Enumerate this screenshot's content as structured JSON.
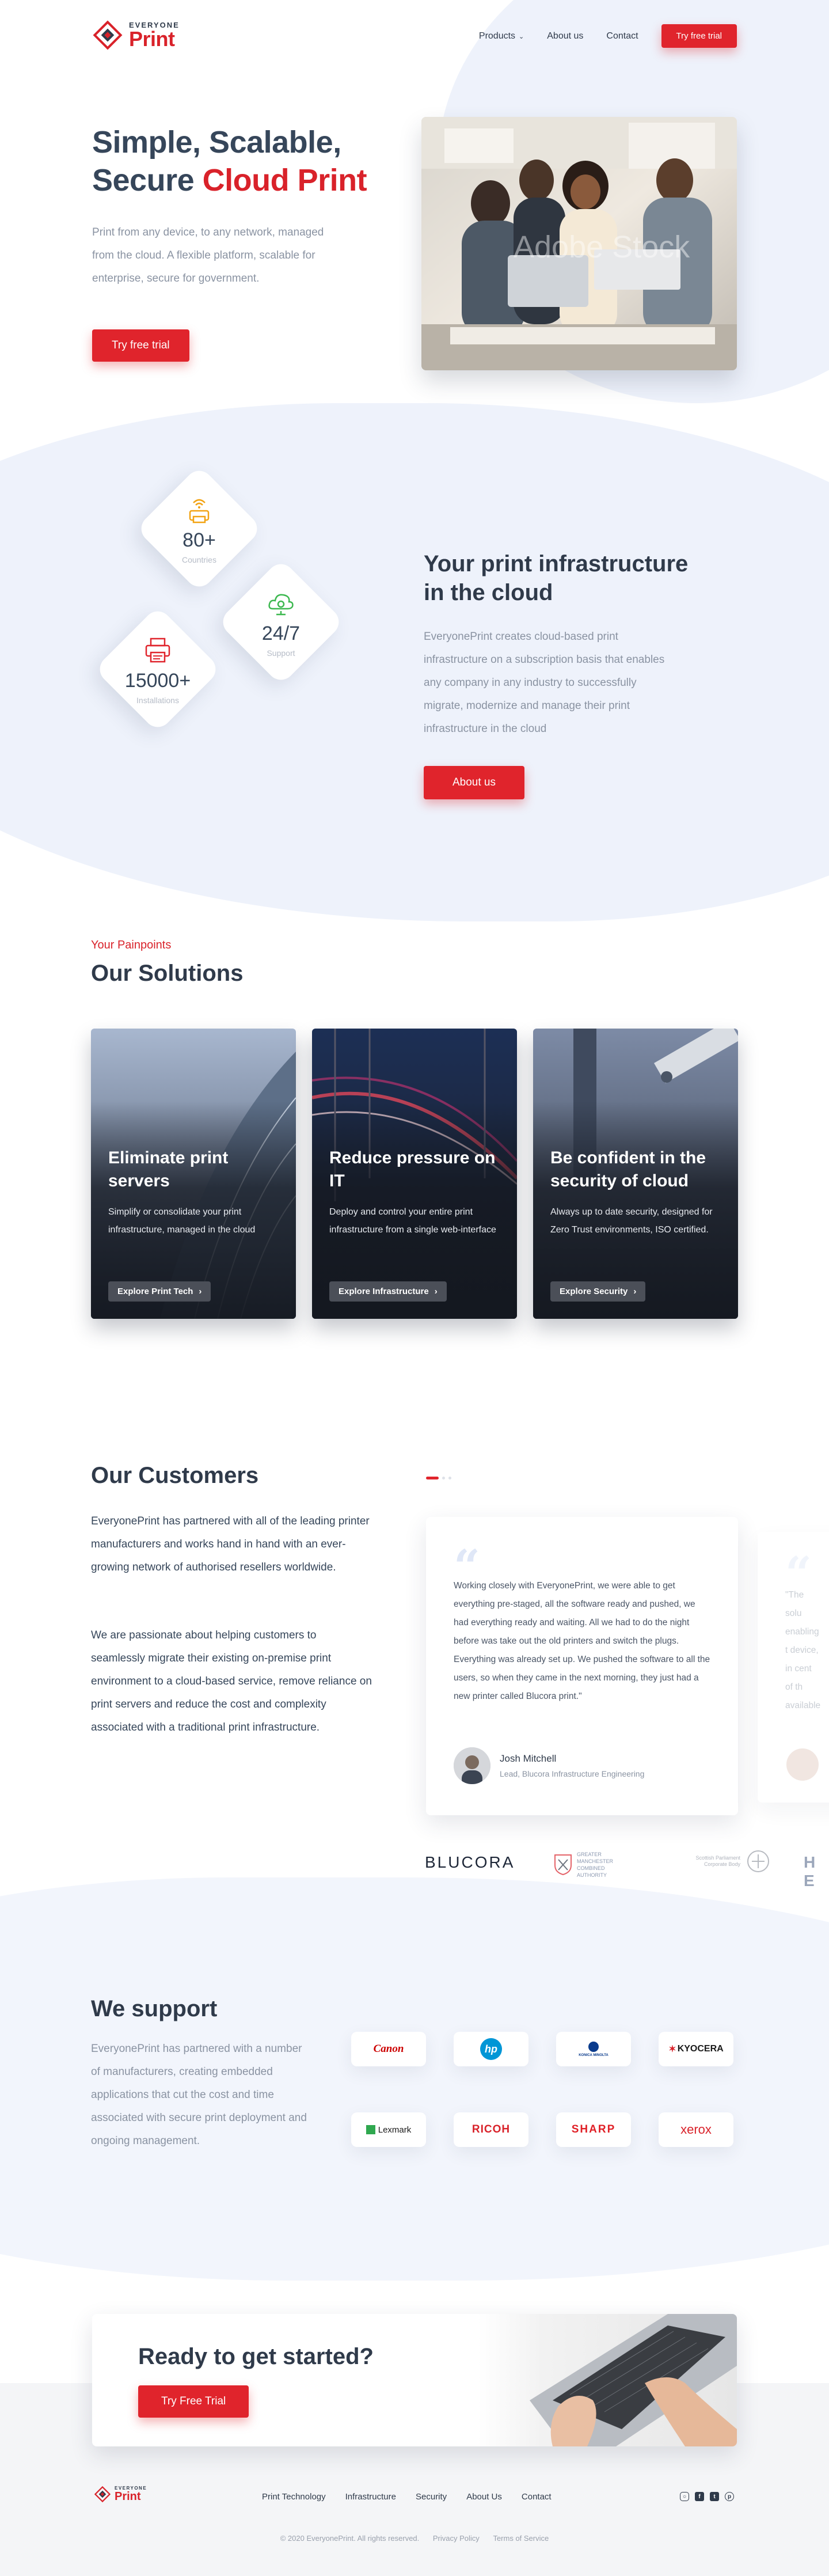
{
  "header": {
    "logo_top": "EVERYONE",
    "logo_bottom": "Print",
    "nav": [
      {
        "label": "Products"
      },
      {
        "label": "About us"
      },
      {
        "label": "Contact"
      }
    ],
    "cta_label": "Try free trial"
  },
  "hero": {
    "title_line1": "Simple, Scalable,",
    "title_line2_plain": "Secure ",
    "title_line2_accent": "Cloud Print",
    "text": "Print from any device, to any network, managed from the cloud. A flexible platform, scalable for enterprise, secure for government.",
    "button": "Try free trial",
    "photo_watermark": "Adobe Stock"
  },
  "stats": [
    {
      "icon": "wifi-printer-icon",
      "value": "80+",
      "label": "Countries"
    },
    {
      "icon": "cloud-settings-icon",
      "value": "24/7",
      "label": "Support"
    },
    {
      "icon": "printer-icon",
      "value": "15000+",
      "label": "Installations"
    }
  ],
  "infra": {
    "title_line1": "Your print infrastructure",
    "title_line2": "in the cloud",
    "text": "EveryonePrint creates cloud-based print infrastructure on a subscription basis that enables any company in any industry to successfully migrate, modernize and manage their print infrastructure in the cloud",
    "button": "About us"
  },
  "solutions": {
    "kicker": "Your Painpoints",
    "title": "Our Solutions",
    "cards": [
      {
        "title": "Eliminate print servers",
        "text": "Simplify or consolidate your print infrastructure, managed in the cloud",
        "button": "Explore Print Tech"
      },
      {
        "title": "Reduce pressure on IT",
        "text": "Deploy and control your entire print infrastructure from a single web-interface",
        "button": "Explore Infrastructure"
      },
      {
        "title": "Be confident in the security of cloud",
        "text": "Always up to date security, designed for Zero Trust environments, ISO certified.",
        "button": "Explore Security"
      }
    ]
  },
  "customers": {
    "title": "Our Customers",
    "para1": "EveryonePrint has partnered with all of the leading printer manufacturers and works hand in hand with an ever-growing network of authorised resellers worldwide.",
    "para2": "We are passionate about helping customers to seamlessly migrate their existing on-premise print environment to a cloud-based service, remove reliance on print servers and reduce the cost and complexity associated with a traditional print infrastructure.",
    "testimonial": {
      "quote": "Working closely with EveryonePrint, we were able to get everything pre-staged, all the software ready and pushed, we had everything ready and waiting. All we had to do the night before was take out the old printers and switch the plugs. Everything was already set up. We pushed the software to all the users, so when they came in the next morning, they just had a new printer called Blucora print.\"",
      "name": "Josh Mitchell",
      "role": "Lead, Blucora Infrastructure Engineering"
    },
    "next_testimonial_preview": "\"The solu enabling t device, in cent of th available",
    "logos": [
      "BLUCORA",
      "GREATER MANCHESTER COMBINED AUTHORITY",
      "Scottish Parliament Corporate Body",
      "H E"
    ]
  },
  "support": {
    "title": "We support",
    "text": "EveryonePrint has partnered with a number of manufacturers, creating embedded applications that cut the cost and time associated with secure print deployment and ongoing management.",
    "vendors": [
      {
        "name": "Canon",
        "color": "#cc0000"
      },
      {
        "name": "hp",
        "color": "#0096d6"
      },
      {
        "name": "KONICA MINOLTA",
        "color": "#0a3b8c"
      },
      {
        "name": "KYOCERA",
        "color": "#1a1a1a"
      },
      {
        "name": "Lexmark",
        "color": "#1a1a1a"
      },
      {
        "name": "RICOH",
        "color": "#d9222a"
      },
      {
        "name": "SHARP",
        "color": "#e01f26"
      },
      {
        "name": "xerox",
        "color": "#d9222a"
      }
    ]
  },
  "cta": {
    "title": "Ready to get started?",
    "button": "Try Free Trial"
  },
  "footer": {
    "logo_top": "EVERYONE",
    "logo_bottom": "Print",
    "nav": [
      "Print Technology",
      "Infrastructure",
      "Security",
      "About Us",
      "Contact"
    ],
    "social": [
      "instagram-icon",
      "facebook-icon",
      "twitter-icon",
      "pinterest-icon"
    ],
    "copyright": "© 2020 EveryonePrint. All rights reserved.",
    "privacy": "Privacy Policy",
    "terms": "Terms of Service"
  },
  "colors": {
    "accent": "#e0242c",
    "text_dark": "#2f3a4a",
    "text_muted": "#8a93a2",
    "bg_blob": "#eef2fb"
  }
}
